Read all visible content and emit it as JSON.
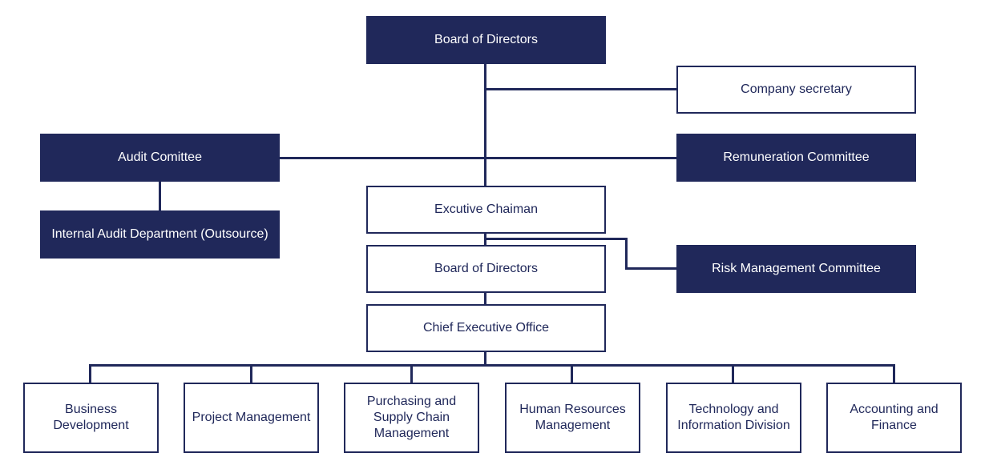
{
  "colors": {
    "primary": "#20285a",
    "background": "#ffffff"
  },
  "nodes": {
    "board_top": "Board of Directors",
    "company_secretary": "Company secretary",
    "audit_committee": "Audit Comittee",
    "remuneration_committee": "Remuneration Committee",
    "internal_audit": "Internal Audit Department (Outsource)",
    "executive_chairman": "Excutive Chaiman",
    "board_second": "Board of Directors",
    "risk_management": "Risk Management Committee",
    "ceo": "Chief Executive Office",
    "departments": [
      "Business Development",
      "Project Management",
      "Purchasing and Supply Chain Management",
      "Human Resources Management",
      "Technology and Information Division",
      "Accounting and Finance"
    ]
  }
}
